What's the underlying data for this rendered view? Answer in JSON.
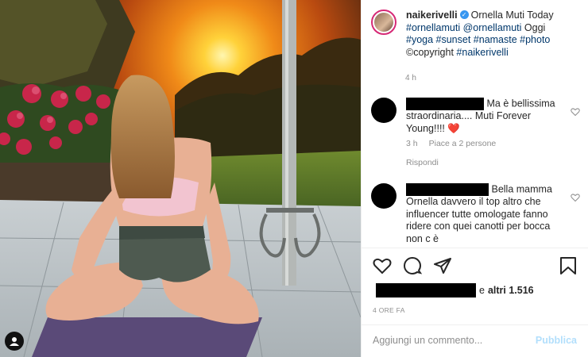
{
  "post": {
    "username": "naikerivelli",
    "caption_title": "Ornella Muti Today",
    "caption_tags": "#ornellamuti @ornellamuti",
    "caption_word": "Oggi",
    "caption_tags2": "#yoga #sunset #namaste #photo",
    "caption_copyright": "©copyright",
    "caption_tag3": "#naikerivelli",
    "time": "4 h",
    "likes_suffix": "e",
    "likes_count": "altri 1.516",
    "date": "4 ORE FA"
  },
  "comments": [
    {
      "text": "Ma è bellissima straordinaria.... Muti Forever Young!!!! ❤️",
      "time": "3 h",
      "likes": "Piace a 2 persone",
      "reply": "Rispondi"
    },
    {
      "text": "Bella mamma Ornella davvero il top altro che influencer tutte omologate fanno ridere con quei canotti per bocca non c è"
    }
  ],
  "add_comment": {
    "placeholder": "Aggiungi un commento...",
    "publish": "Pubblica"
  },
  "colors": {
    "link": "#00376b",
    "verified": "#3897f0",
    "publish_disabled": "#b2dffc"
  },
  "icons": [
    "heart-icon",
    "comment-icon",
    "share-icon",
    "bookmark-icon",
    "user-tag-icon",
    "verified-icon"
  ]
}
